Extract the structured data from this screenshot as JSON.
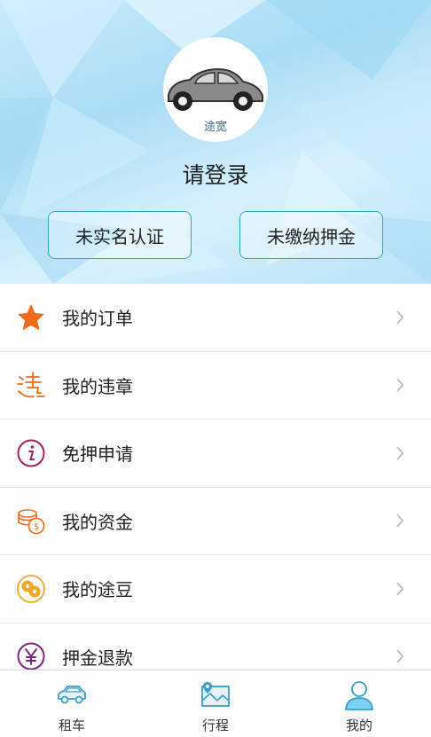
{
  "header": {
    "avatar_name": "途宽",
    "login_prompt": "请登录",
    "verify_button": "未实名认证",
    "deposit_button": "未缴纳押金"
  },
  "menu": {
    "items": [
      {
        "label": "我的订单",
        "icon": "star-icon",
        "color": "#f06a1a"
      },
      {
        "label": "我的违章",
        "icon": "violation-icon",
        "color": "#f06a1a"
      },
      {
        "label": "免押申请",
        "icon": "info-icon",
        "color": "#a0245c"
      },
      {
        "label": "我的资金",
        "icon": "coins-icon",
        "color": "#f06a1a"
      },
      {
        "label": "我的途豆",
        "icon": "beans-icon",
        "color": "#f5a623"
      },
      {
        "label": "押金退款",
        "icon": "yen-icon",
        "color": "#7a2a7a"
      }
    ]
  },
  "bottom_nav": {
    "items": [
      {
        "label": "租车",
        "icon": "car-icon",
        "active": false
      },
      {
        "label": "行程",
        "icon": "map-icon",
        "active": false
      },
      {
        "label": "我的",
        "icon": "user-icon",
        "active": true
      }
    ]
  },
  "colors": {
    "accent": "#36a6c8",
    "orange": "#f06a1a",
    "header_bg": "#b7e3f8"
  }
}
